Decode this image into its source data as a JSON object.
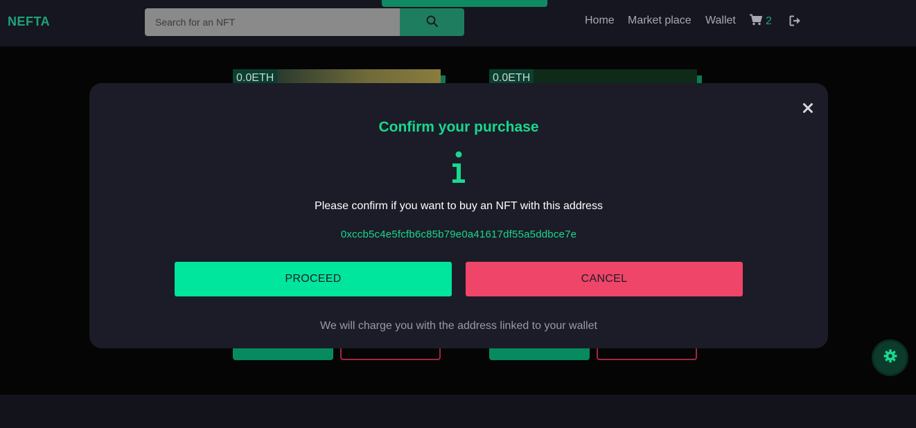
{
  "header": {
    "logo": "NEFTA",
    "search": {
      "placeholder": "Search for an NFT",
      "value": ""
    },
    "nav": {
      "home": "Home",
      "marketplace": "Market place",
      "wallet": "Wallet"
    },
    "cart_count": "2"
  },
  "cards": [
    {
      "price": "0.0ETH"
    },
    {
      "price": "0.0ETH"
    }
  ],
  "modal": {
    "title": "Confirm your purchase",
    "message": "Please confirm if you want to buy an NFT with this address",
    "address": "0xccb5c4e5fcfb6c85b79e0a41617df55a5ddbce7e",
    "proceed_label": "PROCEED",
    "cancel_label": "CANCEL",
    "note": "We will charge you with the address linked to your wallet"
  },
  "colors": {
    "accent": "#19d88f",
    "proceed": "#00e69d",
    "cancel": "#ef4568",
    "modal_bg": "#1b1c27"
  },
  "icons": {
    "search": "search-icon",
    "cart": "cart-icon",
    "logout": "logout-icon",
    "close": "close-icon",
    "info": "info-icon",
    "settings": "gear-icon"
  }
}
